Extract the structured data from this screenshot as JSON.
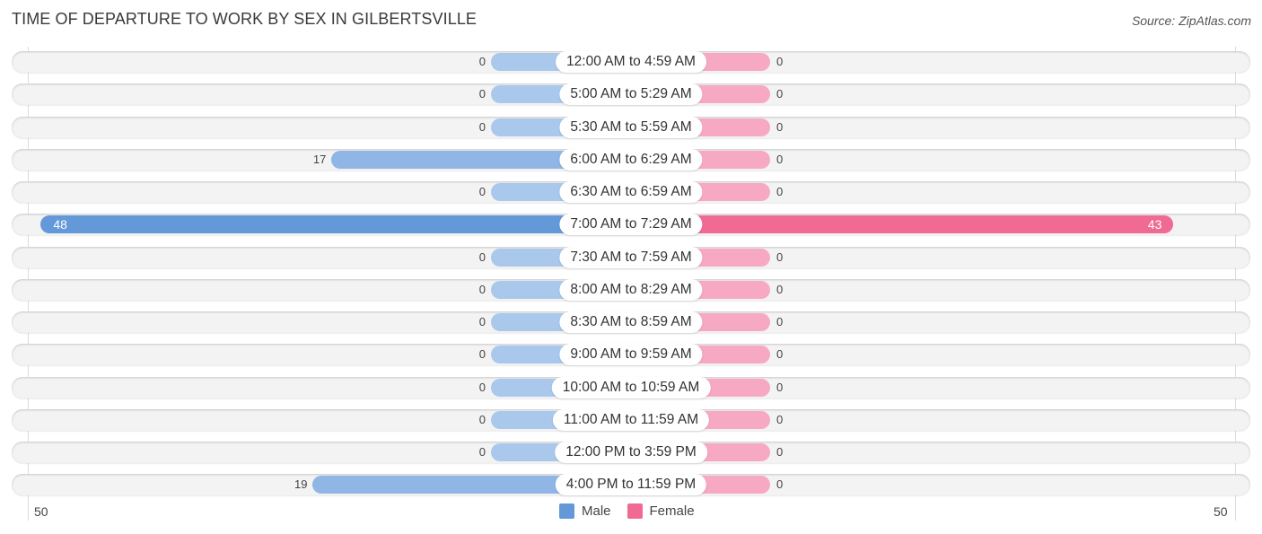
{
  "header": {
    "title": "TIME OF DEPARTURE TO WORK BY SEX IN GILBERTSVILLE",
    "source": "Source: ZipAtlas.com"
  },
  "colors": {
    "male": "#6399d8",
    "male_light": "#a9c8ec",
    "female": "#f06a94",
    "female_light": "#f7a9c3"
  },
  "chart_data": {
    "type": "bar",
    "orientation": "horizontal-diverging",
    "title": "TIME OF DEPARTURE TO WORK BY SEX IN GILBERTSVILLE",
    "categories": [
      "12:00 AM to 4:59 AM",
      "5:00 AM to 5:29 AM",
      "5:30 AM to 5:59 AM",
      "6:00 AM to 6:29 AM",
      "6:30 AM to 6:59 AM",
      "7:00 AM to 7:29 AM",
      "7:30 AM to 7:59 AM",
      "8:00 AM to 8:29 AM",
      "8:30 AM to 8:59 AM",
      "9:00 AM to 9:59 AM",
      "10:00 AM to 10:59 AM",
      "11:00 AM to 11:59 AM",
      "12:00 PM to 3:59 PM",
      "4:00 PM to 11:59 PM"
    ],
    "series": [
      {
        "name": "Male",
        "values": [
          0,
          0,
          0,
          17,
          0,
          48,
          0,
          0,
          0,
          0,
          0,
          0,
          0,
          19
        ]
      },
      {
        "name": "Female",
        "values": [
          0,
          0,
          0,
          0,
          0,
          43,
          0,
          0,
          0,
          0,
          0,
          0,
          0,
          0
        ]
      }
    ],
    "axis": {
      "left_tick": "50",
      "right_tick": "50",
      "range": [
        -50,
        50
      ]
    },
    "legend": {
      "position": "bottom-center",
      "entries": [
        "Male",
        "Female"
      ]
    },
    "grid": false
  }
}
